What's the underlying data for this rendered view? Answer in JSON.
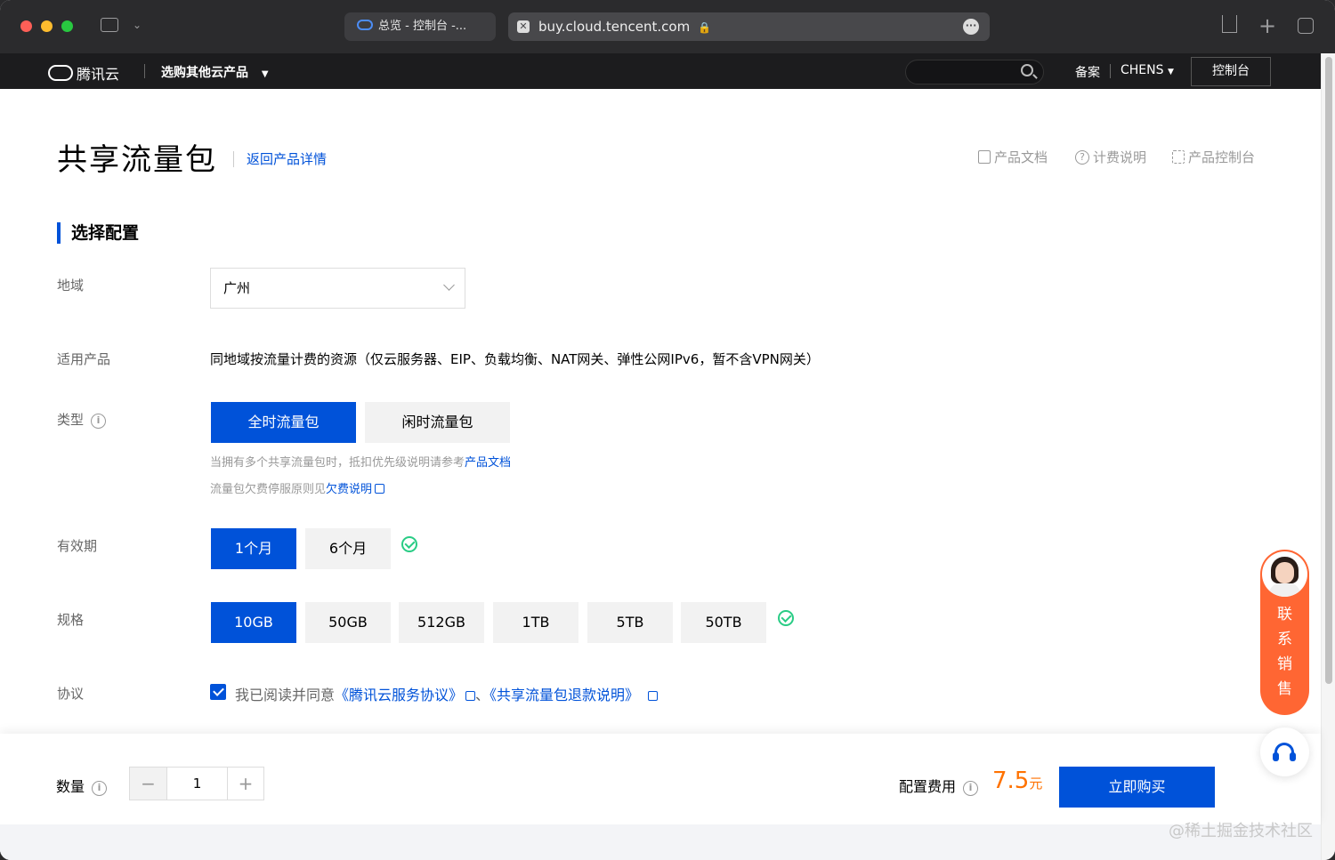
{
  "browser": {
    "tab_title": "总览 - 控制台 -...",
    "url": "buy.cloud.tencent.com"
  },
  "site_nav": {
    "logo": "腾讯云",
    "products_menu": "选购其他云产品",
    "beian": "备案",
    "user": "CHENS",
    "console": "控制台"
  },
  "header": {
    "title": "共享流量包",
    "back_link": "返回产品详情",
    "links": [
      "产品文档",
      "计费说明",
      "产品控制台"
    ]
  },
  "section_title": "选择配置",
  "form": {
    "region_label": "地域",
    "region_value": "广州",
    "products_label": "适用产品",
    "products_text": "同地域按流量计费的资源（仅云服务器、EIP、负载均衡、NAT网关、弹性公网IPv6，暂不含VPN网关）",
    "type_label": "类型",
    "type_options": [
      "全时流量包",
      "闲时流量包"
    ],
    "type_hint1_prefix": "当拥有多个共享流量包时，抵扣优先级说明请参考",
    "type_hint1_link": "产品文档",
    "type_hint2_prefix": "流量包欠费停服原则见",
    "type_hint2_link": "欠费说明",
    "validity_label": "有效期",
    "validity_options": [
      "1个月",
      "6个月"
    ],
    "spec_label": "规格",
    "spec_options": [
      "10GB",
      "50GB",
      "512GB",
      "1TB",
      "5TB",
      "50TB"
    ],
    "agreement_label": "协议",
    "agreement_prefix": "我已阅读并同意",
    "agreement_link1": "《腾讯云服务协议》",
    "agreement_sep": "、",
    "agreement_link2": "《共享流量包退款说明》"
  },
  "bottom": {
    "quantity_label": "数量",
    "quantity_value": "1",
    "minus": "−",
    "plus": "+",
    "fee_label": "配置费用",
    "price": "7.5",
    "price_unit": "元",
    "buy_button": "立即购买"
  },
  "float": {
    "contact_sales": "联\n系\n销\n售"
  },
  "watermark": "@稀土掘金技术社区",
  "colors": {
    "primary": "#0052d9",
    "price": "#ff7200",
    "sales": "#ff6633",
    "success": "#29cc85"
  }
}
